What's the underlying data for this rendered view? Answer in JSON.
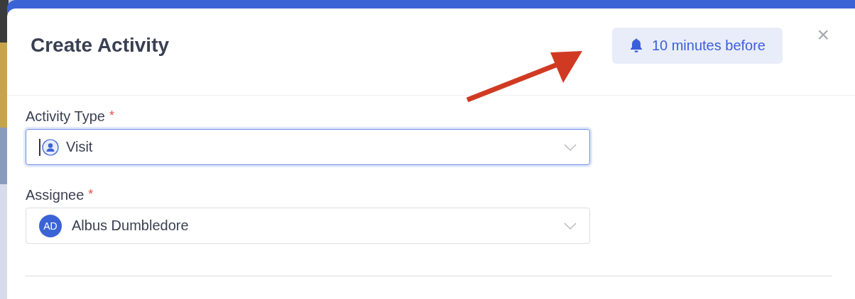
{
  "dialog": {
    "title": "Create Activity",
    "reminder": {
      "label": "10 minutes before"
    },
    "close": "×"
  },
  "fields": [
    {
      "label": "Activity Type",
      "required_mark": "*",
      "kind": "type",
      "value": "Visit",
      "focused": true
    },
    {
      "label": "Assignee",
      "required_mark": "*",
      "kind": "person",
      "value": "Albus Dumbledore",
      "initials": "AD",
      "focused": false
    }
  ]
}
